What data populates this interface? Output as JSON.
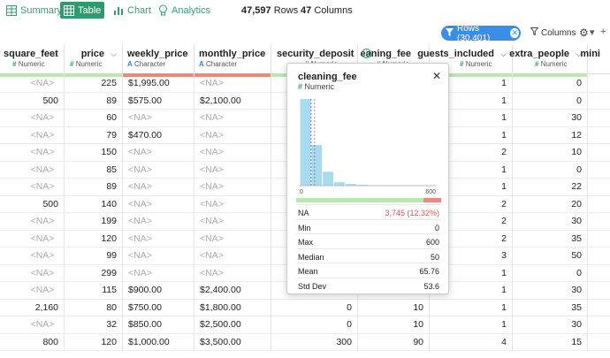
{
  "top_tabs": [
    {
      "label": "Summary",
      "icon": "summary-grid-icon",
      "active": false
    },
    {
      "label": "Table",
      "icon": "table-icon",
      "active": true
    },
    {
      "label": "Chart",
      "icon": "chart-icon",
      "active": false
    },
    {
      "label": "Analytics",
      "icon": "lightbulb-icon",
      "active": false
    }
  ],
  "counts": {
    "rows_value": "47,597",
    "rows_label": "Rows",
    "cols_value": "47",
    "cols_label": "Columns"
  },
  "toolbar": {
    "filter_pill": "Rows (30,401)",
    "columns_label": "Columns"
  },
  "colors": {
    "accent_green": "#2e9a6e",
    "pill_blue": "#3a8ee8",
    "na_red": "#d9534f",
    "bar_green": "#b9e6b1",
    "bar_red": "#e88a80",
    "hist_blue": "#a8dbf0"
  },
  "columns": [
    {
      "name": "square_feet",
      "type": "Numeric",
      "sym": "#"
    },
    {
      "name": "price",
      "type": "Numeric",
      "sym": "#"
    },
    {
      "name": "weekly_price",
      "type": "Character",
      "sym": "A"
    },
    {
      "name": "monthly_price",
      "type": "Character",
      "sym": "A"
    },
    {
      "name": "security_deposit",
      "type": "Numeric",
      "sym": "#"
    },
    {
      "name": "eaning_fee",
      "type": "Numeric",
      "sym": "#"
    },
    {
      "name": "guests_included",
      "type": "Numeric",
      "sym": "#"
    },
    {
      "name": "extra_people",
      "type": "Numeric",
      "sym": "#"
    },
    {
      "name": "mini",
      "type": "",
      "sym": ""
    }
  ],
  "rows": [
    [
      "<NA>",
      "225",
      "$1,995.00",
      "<NA>",
      "",
      "",
      "1",
      "0"
    ],
    [
      "500",
      "89",
      "$575.00",
      "$2,100.00",
      "",
      "",
      "1",
      "0"
    ],
    [
      "<NA>",
      "60",
      "<NA>",
      "<NA>",
      "",
      "",
      "1",
      "30"
    ],
    [
      "<NA>",
      "79",
      "$470.00",
      "<NA>",
      "",
      "",
      "1",
      "12"
    ],
    [
      "<NA>",
      "150",
      "<NA>",
      "<NA>",
      "",
      "",
      "2",
      "10"
    ],
    [
      "<NA>",
      "85",
      "<NA>",
      "<NA>",
      "",
      "",
      "1",
      "0"
    ],
    [
      "<NA>",
      "89",
      "<NA>",
      "<NA>",
      "",
      "",
      "1",
      "22"
    ],
    [
      "500",
      "140",
      "<NA>",
      "<NA>",
      "",
      "",
      "2",
      "20"
    ],
    [
      "<NA>",
      "199",
      "<NA>",
      "<NA>",
      "",
      "",
      "2",
      "30"
    ],
    [
      "<NA>",
      "120",
      "<NA>",
      "<NA>",
      "",
      "",
      "2",
      "35"
    ],
    [
      "<NA>",
      "99",
      "<NA>",
      "<NA>",
      "",
      "",
      "3",
      "50"
    ],
    [
      "<NA>",
      "299",
      "<NA>",
      "<NA>",
      "",
      "",
      "1",
      "0"
    ],
    [
      "<NA>",
      "115",
      "$900.00",
      "$2,400.00",
      "",
      "",
      "1",
      "30"
    ],
    [
      "2,160",
      "80",
      "$750.00",
      "$1,800.00",
      "0",
      "10",
      "1",
      "35"
    ],
    [
      "<NA>",
      "32",
      "$850.00",
      "$2,500.00",
      "0",
      "10",
      "1",
      "30"
    ],
    [
      "800",
      "120",
      "$1,000.00",
      "$3,500.00",
      "300",
      "90",
      "4",
      "15"
    ]
  ],
  "popup": {
    "title": "cleaning_fee",
    "type": "Numeric",
    "axis_min": "0",
    "axis_max": "600",
    "na_fraction": 0.1232,
    "stats": [
      {
        "k": "NA",
        "v": "3,745 (12.32%)"
      },
      {
        "k": "Min",
        "v": "0"
      },
      {
        "k": "Max",
        "v": "600"
      },
      {
        "k": "Median",
        "v": "50"
      },
      {
        "k": "Mean",
        "v": "65.76"
      },
      {
        "k": "Std Dev",
        "v": "53.6"
      }
    ]
  },
  "chart_data": {
    "type": "bar",
    "title": "cleaning_fee",
    "xlabel": "",
    "ylabel": "",
    "xlim": [
      0,
      600
    ],
    "bins": [
      0,
      50,
      100,
      150,
      200,
      250,
      300,
      350,
      400,
      450,
      500,
      550
    ],
    "values": [
      1.0,
      0.47,
      0.16,
      0.04,
      0.02,
      0.01,
      0.005,
      0.003,
      0.002,
      0.001,
      0.001,
      0.002
    ],
    "median_line": 50,
    "mean_line": 65.76
  }
}
